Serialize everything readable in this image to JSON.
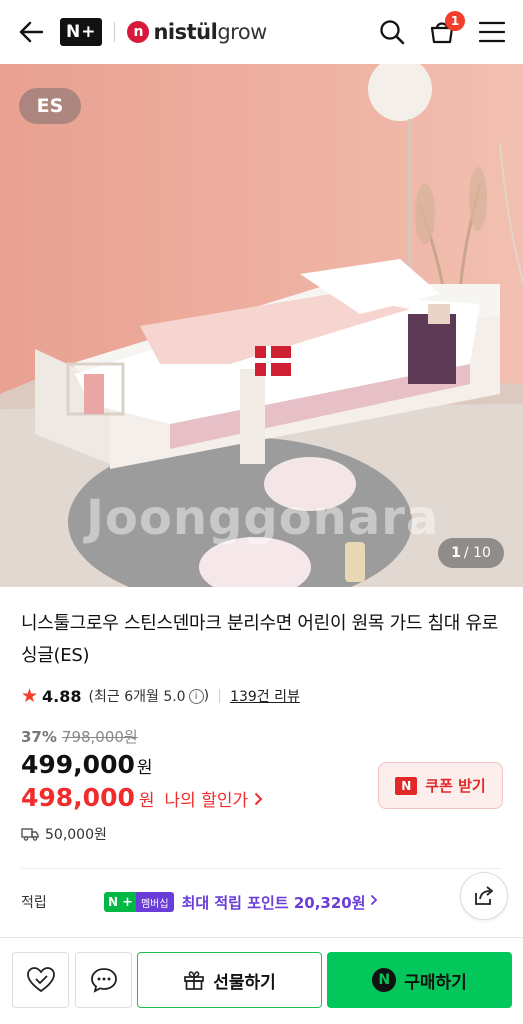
{
  "header": {
    "nplus_label": "N+",
    "brand_mark": "n",
    "brand_name": "nistül",
    "brand_suffix": "grow",
    "cart_count": "1",
    "icons": [
      "back-arrow-icon",
      "search-icon",
      "cart-icon",
      "menu-icon"
    ]
  },
  "hero": {
    "badge": "ES",
    "watermark": "Joonggonara",
    "counter_current": "1",
    "counter_total": "/ 10"
  },
  "product": {
    "title": "니스툴그로우 스틴스덴마크 분리수면 어린이 원목 가드 침대 유로싱글(ES)",
    "rating": "4.88",
    "recent_rating": "(최근 6개월 5.0",
    "recent_close": ")",
    "review_count": "139건 리뷰"
  },
  "price": {
    "discount_pct": "37%",
    "original": "798,000원",
    "sale": "499,000",
    "sale_unit": "원",
    "my_price": "498,000",
    "my_price_unit": "원",
    "my_price_label": "나의 할인가",
    "coupon_button": "쿠폰 받기",
    "coupon_mark": "N"
  },
  "shipping": {
    "fee": "50,000원"
  },
  "points": {
    "label": "적립",
    "badge_n": "N",
    "badge_plus": "+",
    "badge_member": "멤버십",
    "max_points": "최대 적립 포인트 20,320원"
  },
  "bottom_bar": {
    "gift_button": "선물하기",
    "buy_button": "구매하기",
    "buy_mark": "N"
  },
  "colors": {
    "accent_red": "#f02c2c",
    "naver_green": "#03c75a",
    "membership_purple": "#6a3dd8",
    "star": "#f23e2a"
  }
}
